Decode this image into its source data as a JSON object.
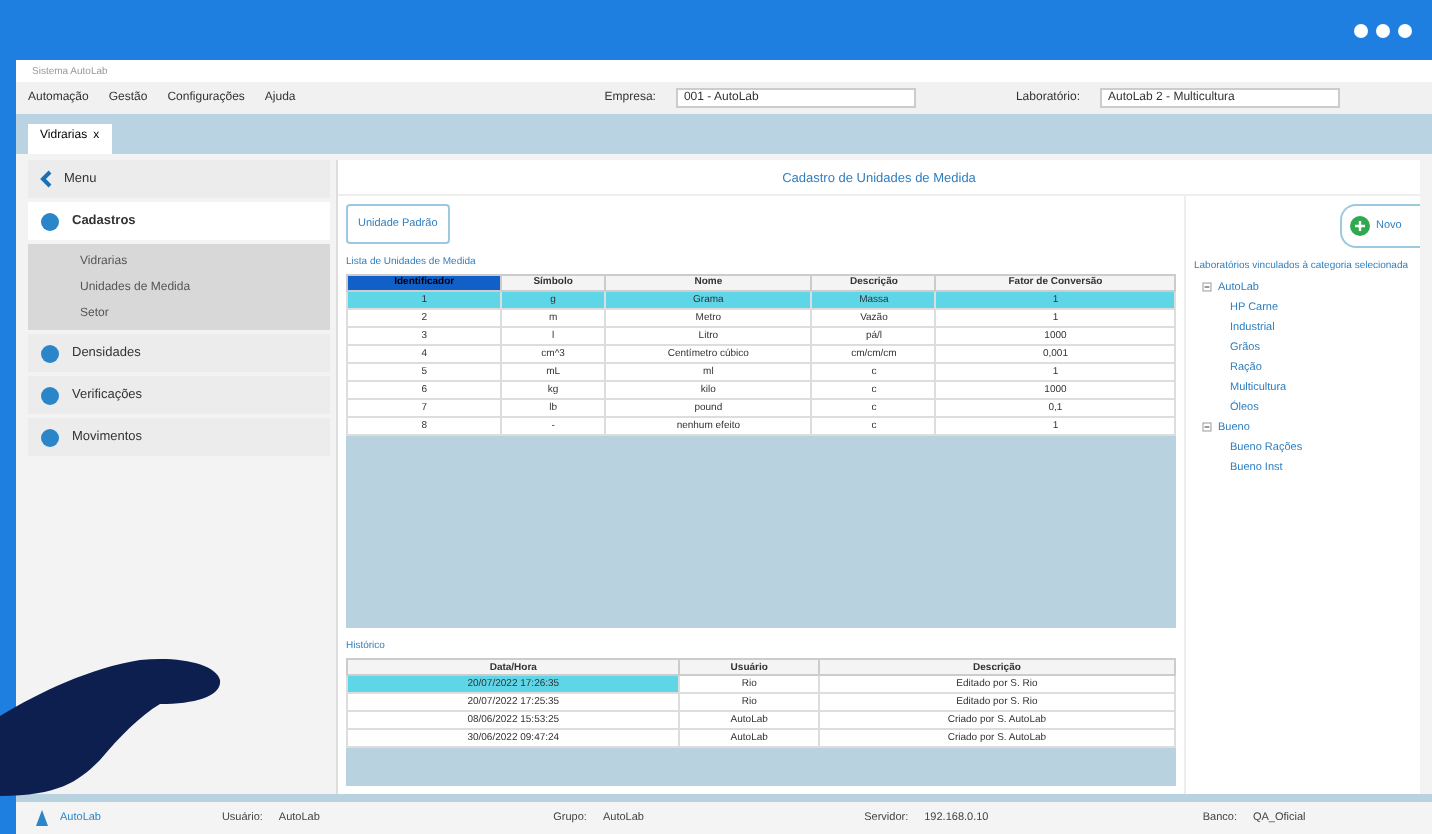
{
  "window": {
    "title": "Sistema AutoLab"
  },
  "menu": [
    "Automação",
    "Gestão",
    "Configurações",
    "Ajuda"
  ],
  "company": {
    "label": "Empresa:",
    "value": "001 - AutoLab"
  },
  "lab": {
    "label": "Laboratório:",
    "value": "AutoLab 2 - Multicultura"
  },
  "tabs": [
    {
      "label": "Vidrarias",
      "close": "x",
      "selected": true
    }
  ],
  "sidebar": {
    "back": "Menu",
    "items": [
      {
        "label": "Cadastros",
        "selected": true,
        "children": [
          {
            "label": "Vidrarias",
            "selected": false
          },
          {
            "label": "Unidades de Medida",
            "selected": false
          },
          {
            "label": "Setor",
            "selected": false
          }
        ]
      },
      {
        "label": "Densidades",
        "selected": false
      },
      {
        "label": "Verificações",
        "selected": false
      },
      {
        "label": "Movimentos",
        "selected": false
      }
    ]
  },
  "page_title": "Cadastro de Unidades de Medida",
  "default_button": "Unidade Padrão",
  "new_button": "Novo",
  "units": {
    "caption": "Lista de Unidades de Medida",
    "columns": [
      "Identificador",
      "Símbolo",
      "Nome",
      "Descrição",
      "Fator de Conversão"
    ],
    "rows": [
      {
        "cells": [
          "1",
          "g",
          "Grama",
          "Massa",
          "1"
        ],
        "selected": true
      },
      {
        "cells": [
          "2",
          "m",
          "Metro",
          "Vazão",
          "1"
        ],
        "selected": false
      },
      {
        "cells": [
          "3",
          "l",
          "Litro",
          "pá/l",
          "1000"
        ],
        "selected": false
      },
      {
        "cells": [
          "4",
          "cm^3",
          "Centímetro cúbico",
          "cm/cm/cm",
          "0,001"
        ],
        "selected": false
      },
      {
        "cells": [
          "5",
          "mL",
          "ml",
          "c",
          "1"
        ],
        "selected": false
      },
      {
        "cells": [
          "6",
          "kg",
          "kilo",
          "c",
          "1000"
        ],
        "selected": false
      },
      {
        "cells": [
          "7",
          "lb",
          "pound",
          "c",
          "0,1"
        ],
        "selected": false
      },
      {
        "cells": [
          "8",
          "-",
          "nenhum efeito",
          "c",
          "1"
        ],
        "selected": false
      }
    ]
  },
  "history": {
    "caption": "Histórico",
    "columns": [
      "Data/Hora",
      "Usuário",
      "Descrição"
    ],
    "rows": [
      {
        "cells": [
          "20/07/2022 17:26:35",
          "Rio",
          "Editado por S. Rio"
        ],
        "selected": true
      },
      {
        "cells": [
          "20/07/2022 17:25:35",
          "Rio",
          "Editado por S. Rio"
        ],
        "selected": false
      },
      {
        "cells": [
          "08/06/2022 15:53:25",
          "AutoLab",
          "Criado por S. AutoLab"
        ],
        "selected": false
      },
      {
        "cells": [
          "30/06/2022 09:47:24",
          "AutoLab",
          "Criado por S. AutoLab"
        ],
        "selected": false
      }
    ]
  },
  "labs": {
    "caption": "Laboratórios vinculados à categoria selecionada",
    "tree": [
      {
        "label": "AutoLab",
        "expanded": true,
        "children": [
          {
            "label": "HP Carne"
          },
          {
            "label": "Industrial"
          },
          {
            "label": "Grãos"
          },
          {
            "label": "Ração"
          },
          {
            "label": "Multicultura"
          },
          {
            "label": "Óleos"
          }
        ]
      },
      {
        "label": "Bueno",
        "expanded": true,
        "children": [
          {
            "label": "Bueno Rações"
          },
          {
            "label": "Bueno Inst"
          }
        ]
      }
    ]
  },
  "status_bar": {
    "brand": "AutoLab",
    "fields": [
      {
        "label": "Usuário:",
        "value": "AutoLab"
      },
      {
        "label": "Grupo:",
        "value": "AutoLab"
      },
      {
        "label": "Servidor:",
        "value": "192.168.0.10"
      },
      {
        "label": "Banco:",
        "value": "QA_Oficial"
      }
    ]
  }
}
